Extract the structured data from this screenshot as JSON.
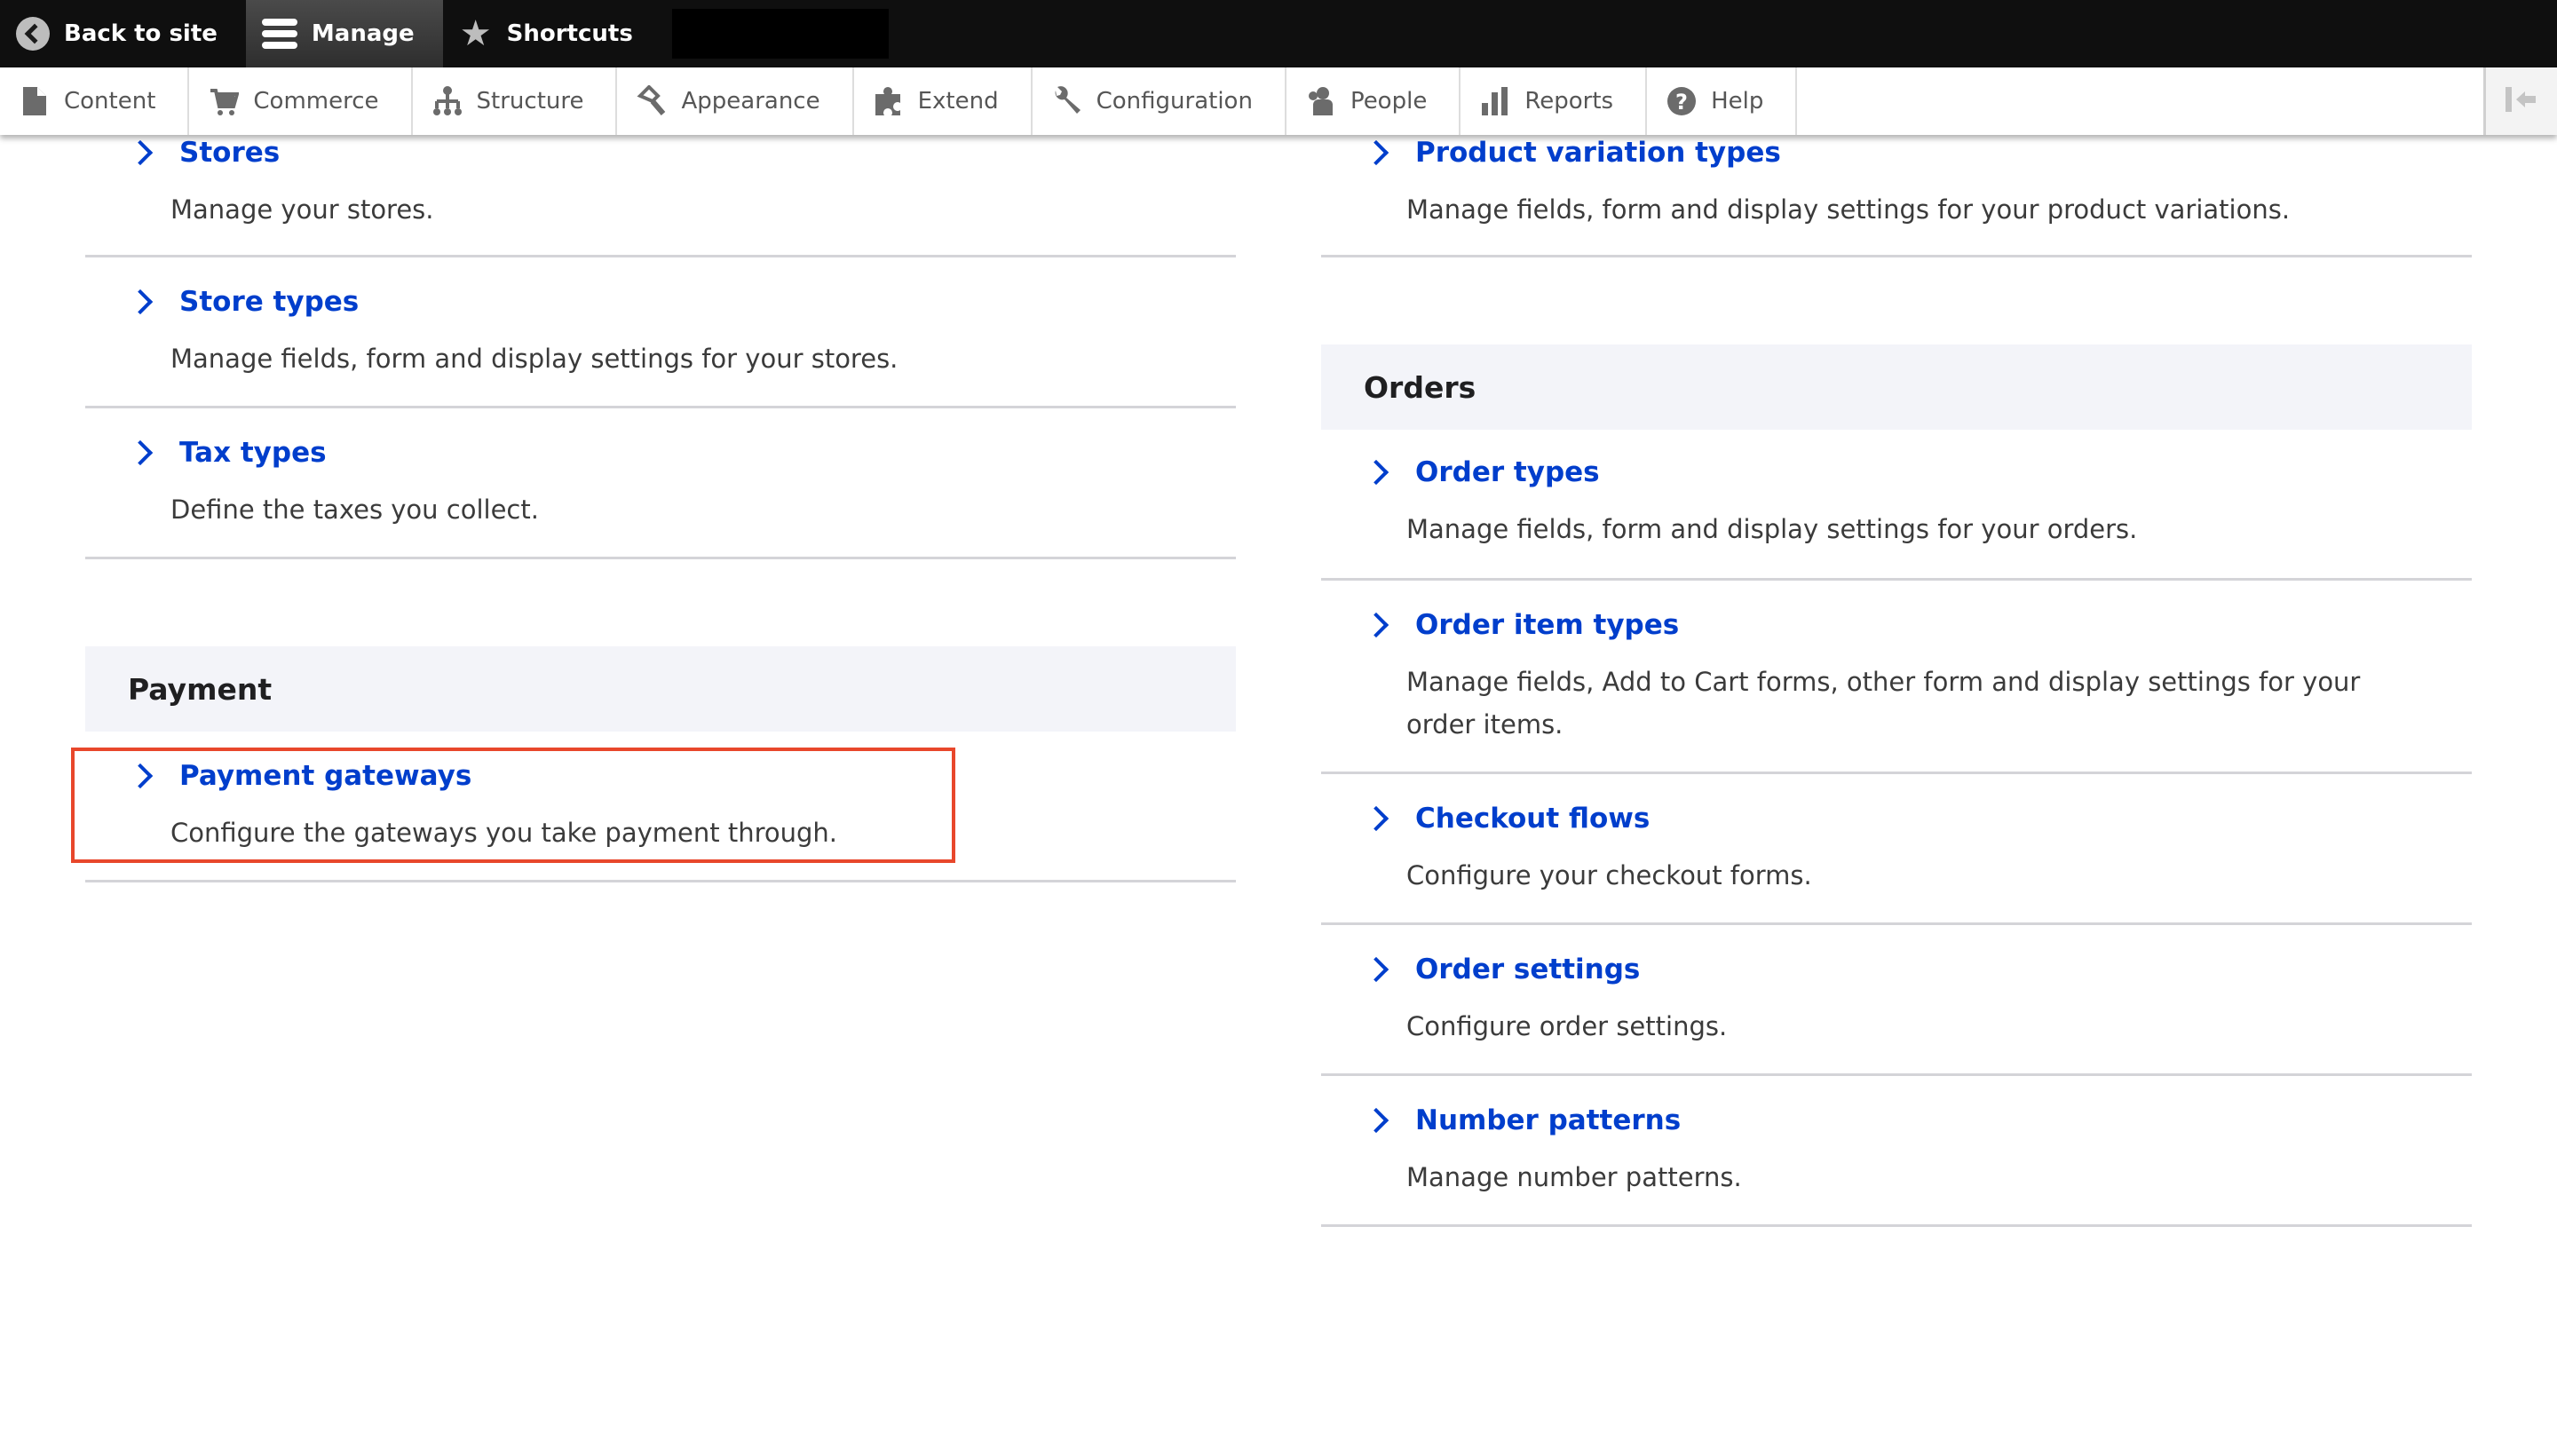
{
  "toolbar": {
    "back_label": "Back to site",
    "manage_label": "Manage",
    "shortcuts_label": "Shortcuts"
  },
  "admin_menu": [
    {
      "label": "Content",
      "icon": "file-icon"
    },
    {
      "label": "Commerce",
      "icon": "cart-icon"
    },
    {
      "label": "Structure",
      "icon": "sitemap-icon"
    },
    {
      "label": "Appearance",
      "icon": "paintbrush-icon"
    },
    {
      "label": "Extend",
      "icon": "puzzle-icon"
    },
    {
      "label": "Configuration",
      "icon": "wrench-icon"
    },
    {
      "label": "People",
      "icon": "person-icon"
    },
    {
      "label": "Reports",
      "icon": "bar-chart-icon"
    },
    {
      "label": "Help",
      "icon": "help-icon"
    }
  ],
  "left_column": {
    "items": [
      {
        "title": "Stores",
        "description": "Manage your stores."
      },
      {
        "title": "Store types",
        "description": "Manage fields, form and display settings for your stores."
      },
      {
        "title": "Tax types",
        "description": "Define the taxes you collect."
      }
    ],
    "payment": {
      "heading": "Payment",
      "items": [
        {
          "title": "Payment gateways",
          "description": "Configure the gateways you take payment through."
        }
      ]
    }
  },
  "right_column": {
    "items": [
      {
        "title": "Product variation types",
        "description": "Manage fields, form and display settings for your product variations."
      }
    ],
    "orders": {
      "heading": "Orders",
      "items": [
        {
          "title": "Order types",
          "description": "Manage fields, form and display settings for your orders."
        },
        {
          "title": "Order item types",
          "description": "Manage fields, Add to Cart forms, other form and display settings for your order items."
        },
        {
          "title": "Checkout flows",
          "description": "Configure your checkout forms."
        },
        {
          "title": "Order settings",
          "description": "Configure order settings."
        },
        {
          "title": "Number patterns",
          "description": "Manage number patterns."
        }
      ]
    }
  },
  "colors": {
    "link": "#003ecc",
    "highlight": "#e8472b",
    "section_bg": "#f3f4f9"
  }
}
